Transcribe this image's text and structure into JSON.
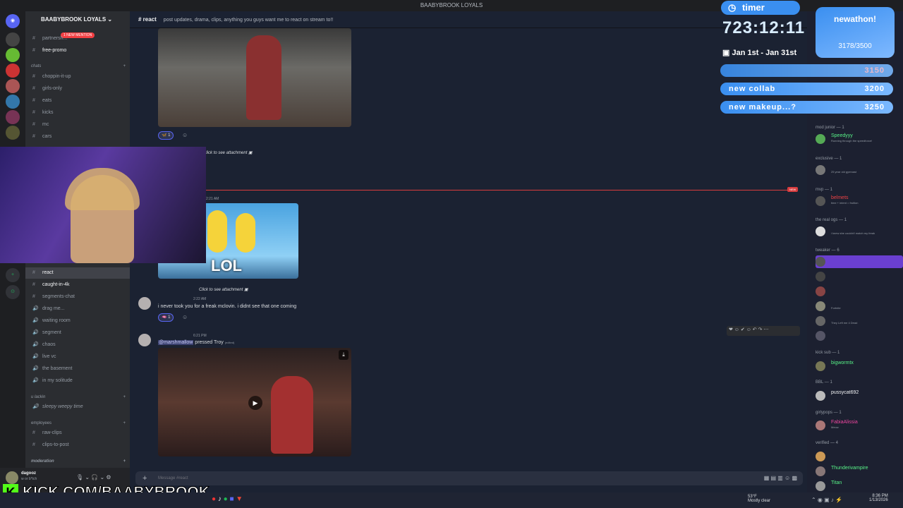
{
  "window": {
    "title": "BAABYBROOK LOYALS"
  },
  "server": {
    "name": "BAABYBROOK LOYALS",
    "mention_badge": "1 NEW MENTION"
  },
  "channels_top": [
    {
      "name": "partnersh..."
    },
    {
      "name": "free-promo"
    }
  ],
  "categories": {
    "chats": "chats",
    "ulackin": "u lackin",
    "employees": "employees",
    "moderation": "moderation"
  },
  "chat_channels": [
    "choppin-it-up",
    "girls-only",
    "eats",
    "kicks",
    "mc",
    "cars"
  ],
  "channels_lower": [
    {
      "name": "react",
      "active": true
    },
    {
      "name": "caught-in-4k"
    },
    {
      "name": "segments-chat"
    },
    {
      "name": "drag me..."
    },
    {
      "name": "waiting room"
    },
    {
      "name": "segment"
    },
    {
      "name": "chaos"
    },
    {
      "name": "live vc"
    },
    {
      "name": "the basement"
    },
    {
      "name": "in my solitude"
    }
  ],
  "ulackin_channels": [
    "sleepy weepy time"
  ],
  "employee_channels": [
    "raw-clips",
    "clips-to-post"
  ],
  "header": {
    "channel": "react",
    "topic": "post updates, drama, clips, anything you guys want me to react on stream to!!"
  },
  "messages": {
    "attach1": "Click to see attachment",
    "ts1": "2:21 AM",
    "gif_text": "LOL",
    "attach2": "Click to see attachment",
    "ts2": "2:22 AM",
    "msg2": "i never took you for a freak mclovin. i didnt see that one coming",
    "ts3": "6:21 PM",
    "mention": "@marshmallow",
    "msg3": "pressed Troy",
    "edited": "(edited)",
    "react_count": "1",
    "react_count2": "1",
    "new_label": "NEW"
  },
  "composer": {
    "placeholder": "Message #react"
  },
  "user": {
    "name": "dagooz",
    "status": "w or b*tch"
  },
  "members": {
    "groups": [
      {
        "label": "mod junior — 1",
        "members": [
          {
            "name": "Speedyyy",
            "status": "Running through the speedforce!",
            "color": "#57f287"
          }
        ]
      },
      {
        "label": "exclusive — 1",
        "members": [
          {
            "name": "",
            "status": "25 year old gymnast",
            "color": "#ed4245"
          }
        ]
      },
      {
        "label": "mvp — 1",
        "members": [
          {
            "name": "belmets",
            "status": "time + intent = fruition",
            "color": "#ed4245"
          }
        ]
      },
      {
        "label": "the real ogs — 1",
        "members": [
          {
            "name": "",
            "status": "i knew she couldn't match my freak",
            "color": "#5865f2"
          }
        ]
      },
      {
        "label": "tweaker — 6",
        "members": [
          {
            "name": "",
            "status": "",
            "color": "#7a5cf0"
          },
          {
            "name": "",
            "status": "",
            "color": "#5865f2"
          },
          {
            "name": "",
            "status": "",
            "color": "#ed4245"
          },
          {
            "name": "",
            "status": "Fortnite",
            "color": "#5865f2"
          },
          {
            "name": "",
            "status": "They Left me 4 Dead",
            "color": "#5865f2"
          },
          {
            "name": "",
            "status": "",
            "color": "#5865f2"
          }
        ]
      },
      {
        "label": "kick sub — 1",
        "members": [
          {
            "name": "bigwormtx",
            "status": "",
            "color": "#57f287"
          }
        ]
      },
      {
        "label": "BBL — 1",
        "members": [
          {
            "name": "pussycat692",
            "status": "",
            "color": "#f2f3f5"
          }
        ]
      },
      {
        "label": "girlypops — 1",
        "members": [
          {
            "name": "FabiaAlissia",
            "status": "Meow",
            "color": "#eb459e"
          }
        ]
      },
      {
        "label": "verified — 4",
        "members": [
          {
            "name": "",
            "status": "",
            "color": "#57f287"
          },
          {
            "name": "Thunderivampire",
            "status": "",
            "color": "#57f287"
          },
          {
            "name": "Titan",
            "status": "",
            "color": "#57f287"
          }
        ]
      }
    ]
  },
  "overlay": {
    "timer_label": "timer",
    "timer_value": "723:12:11",
    "subathon_label": "newathon!",
    "subathon_count": "3178/3500",
    "date_range": "Jan 1st - Jan 31st",
    "goals": [
      {
        "label": "",
        "value": "3150"
      },
      {
        "label": "new collab",
        "value": "3200"
      },
      {
        "label": "new makeup...?",
        "value": "3250"
      }
    ]
  },
  "kick_banner": "KICK.COM/BAABYBROOK",
  "taskbar": {
    "weather_temp": "53°F",
    "weather_desc": "Mostly clear",
    "time": "8:36 PM",
    "date": "1/13/2026"
  }
}
